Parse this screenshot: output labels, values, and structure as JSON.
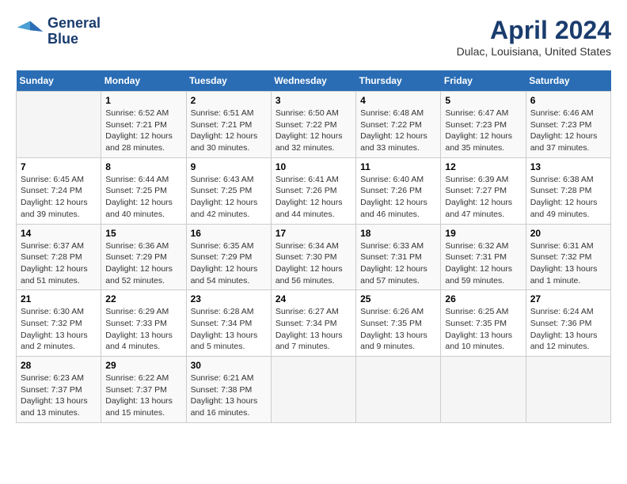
{
  "header": {
    "logo_line1": "General",
    "logo_line2": "Blue",
    "main_title": "April 2024",
    "subtitle": "Dulac, Louisiana, United States"
  },
  "calendar": {
    "days_of_week": [
      "Sunday",
      "Monday",
      "Tuesday",
      "Wednesday",
      "Thursday",
      "Friday",
      "Saturday"
    ],
    "weeks": [
      [
        {
          "num": "",
          "info": ""
        },
        {
          "num": "1",
          "info": "Sunrise: 6:52 AM\nSunset: 7:21 PM\nDaylight: 12 hours\nand 28 minutes."
        },
        {
          "num": "2",
          "info": "Sunrise: 6:51 AM\nSunset: 7:21 PM\nDaylight: 12 hours\nand 30 minutes."
        },
        {
          "num": "3",
          "info": "Sunrise: 6:50 AM\nSunset: 7:22 PM\nDaylight: 12 hours\nand 32 minutes."
        },
        {
          "num": "4",
          "info": "Sunrise: 6:48 AM\nSunset: 7:22 PM\nDaylight: 12 hours\nand 33 minutes."
        },
        {
          "num": "5",
          "info": "Sunrise: 6:47 AM\nSunset: 7:23 PM\nDaylight: 12 hours\nand 35 minutes."
        },
        {
          "num": "6",
          "info": "Sunrise: 6:46 AM\nSunset: 7:23 PM\nDaylight: 12 hours\nand 37 minutes."
        }
      ],
      [
        {
          "num": "7",
          "info": "Sunrise: 6:45 AM\nSunset: 7:24 PM\nDaylight: 12 hours\nand 39 minutes."
        },
        {
          "num": "8",
          "info": "Sunrise: 6:44 AM\nSunset: 7:25 PM\nDaylight: 12 hours\nand 40 minutes."
        },
        {
          "num": "9",
          "info": "Sunrise: 6:43 AM\nSunset: 7:25 PM\nDaylight: 12 hours\nand 42 minutes."
        },
        {
          "num": "10",
          "info": "Sunrise: 6:41 AM\nSunset: 7:26 PM\nDaylight: 12 hours\nand 44 minutes."
        },
        {
          "num": "11",
          "info": "Sunrise: 6:40 AM\nSunset: 7:26 PM\nDaylight: 12 hours\nand 46 minutes."
        },
        {
          "num": "12",
          "info": "Sunrise: 6:39 AM\nSunset: 7:27 PM\nDaylight: 12 hours\nand 47 minutes."
        },
        {
          "num": "13",
          "info": "Sunrise: 6:38 AM\nSunset: 7:28 PM\nDaylight: 12 hours\nand 49 minutes."
        }
      ],
      [
        {
          "num": "14",
          "info": "Sunrise: 6:37 AM\nSunset: 7:28 PM\nDaylight: 12 hours\nand 51 minutes."
        },
        {
          "num": "15",
          "info": "Sunrise: 6:36 AM\nSunset: 7:29 PM\nDaylight: 12 hours\nand 52 minutes."
        },
        {
          "num": "16",
          "info": "Sunrise: 6:35 AM\nSunset: 7:29 PM\nDaylight: 12 hours\nand 54 minutes."
        },
        {
          "num": "17",
          "info": "Sunrise: 6:34 AM\nSunset: 7:30 PM\nDaylight: 12 hours\nand 56 minutes."
        },
        {
          "num": "18",
          "info": "Sunrise: 6:33 AM\nSunset: 7:31 PM\nDaylight: 12 hours\nand 57 minutes."
        },
        {
          "num": "19",
          "info": "Sunrise: 6:32 AM\nSunset: 7:31 PM\nDaylight: 12 hours\nand 59 minutes."
        },
        {
          "num": "20",
          "info": "Sunrise: 6:31 AM\nSunset: 7:32 PM\nDaylight: 13 hours\nand 1 minute."
        }
      ],
      [
        {
          "num": "21",
          "info": "Sunrise: 6:30 AM\nSunset: 7:32 PM\nDaylight: 13 hours\nand 2 minutes."
        },
        {
          "num": "22",
          "info": "Sunrise: 6:29 AM\nSunset: 7:33 PM\nDaylight: 13 hours\nand 4 minutes."
        },
        {
          "num": "23",
          "info": "Sunrise: 6:28 AM\nSunset: 7:34 PM\nDaylight: 13 hours\nand 5 minutes."
        },
        {
          "num": "24",
          "info": "Sunrise: 6:27 AM\nSunset: 7:34 PM\nDaylight: 13 hours\nand 7 minutes."
        },
        {
          "num": "25",
          "info": "Sunrise: 6:26 AM\nSunset: 7:35 PM\nDaylight: 13 hours\nand 9 minutes."
        },
        {
          "num": "26",
          "info": "Sunrise: 6:25 AM\nSunset: 7:35 PM\nDaylight: 13 hours\nand 10 minutes."
        },
        {
          "num": "27",
          "info": "Sunrise: 6:24 AM\nSunset: 7:36 PM\nDaylight: 13 hours\nand 12 minutes."
        }
      ],
      [
        {
          "num": "28",
          "info": "Sunrise: 6:23 AM\nSunset: 7:37 PM\nDaylight: 13 hours\nand 13 minutes."
        },
        {
          "num": "29",
          "info": "Sunrise: 6:22 AM\nSunset: 7:37 PM\nDaylight: 13 hours\nand 15 minutes."
        },
        {
          "num": "30",
          "info": "Sunrise: 6:21 AM\nSunset: 7:38 PM\nDaylight: 13 hours\nand 16 minutes."
        },
        {
          "num": "",
          "info": ""
        },
        {
          "num": "",
          "info": ""
        },
        {
          "num": "",
          "info": ""
        },
        {
          "num": "",
          "info": ""
        }
      ]
    ]
  }
}
